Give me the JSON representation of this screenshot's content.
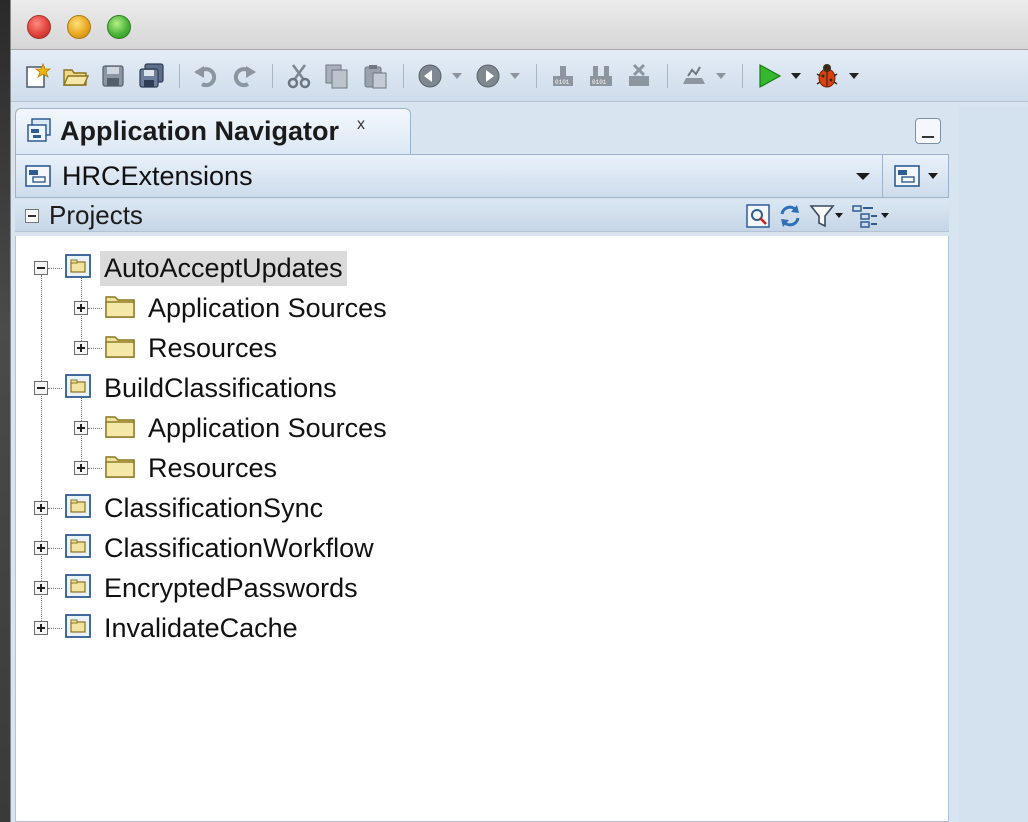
{
  "panel": {
    "tab_title": "Application Navigator",
    "tab_close": "x",
    "application": "HRCExtensions",
    "section_title": "Projects"
  },
  "tree": [
    {
      "label": "AutoAcceptUpdates",
      "level": 0,
      "state": "expanded",
      "selected": true
    },
    {
      "label": "Application Sources",
      "level": 1,
      "state": "collapsed"
    },
    {
      "label": "Resources",
      "level": 1,
      "state": "collapsed"
    },
    {
      "label": "BuildClassifications",
      "level": 0,
      "state": "expanded"
    },
    {
      "label": "Application Sources",
      "level": 1,
      "state": "collapsed"
    },
    {
      "label": "Resources",
      "level": 1,
      "state": "collapsed"
    },
    {
      "label": "ClassificationSync",
      "level": 0,
      "state": "collapsed"
    },
    {
      "label": "ClassificationWorkflow",
      "level": 0,
      "state": "collapsed"
    },
    {
      "label": "EncryptedPasswords",
      "level": 0,
      "state": "collapsed"
    },
    {
      "label": "InvalidateCache",
      "level": 0,
      "state": "collapsed"
    }
  ],
  "toolbar_icons": [
    "new-icon",
    "open-icon",
    "save-icon",
    "save-all-icon",
    "undo-icon",
    "redo-icon",
    "cut-icon",
    "copy-icon",
    "paste-icon",
    "back-icon",
    "forward-icon",
    "make-icon",
    "rebuild-icon",
    "clean-icon",
    "profile-icon",
    "run-icon",
    "debug-icon"
  ],
  "colors": {
    "accent": "#1b9b1b",
    "folder": "#e9dc8c",
    "project_icon": "#3a6fb0"
  }
}
